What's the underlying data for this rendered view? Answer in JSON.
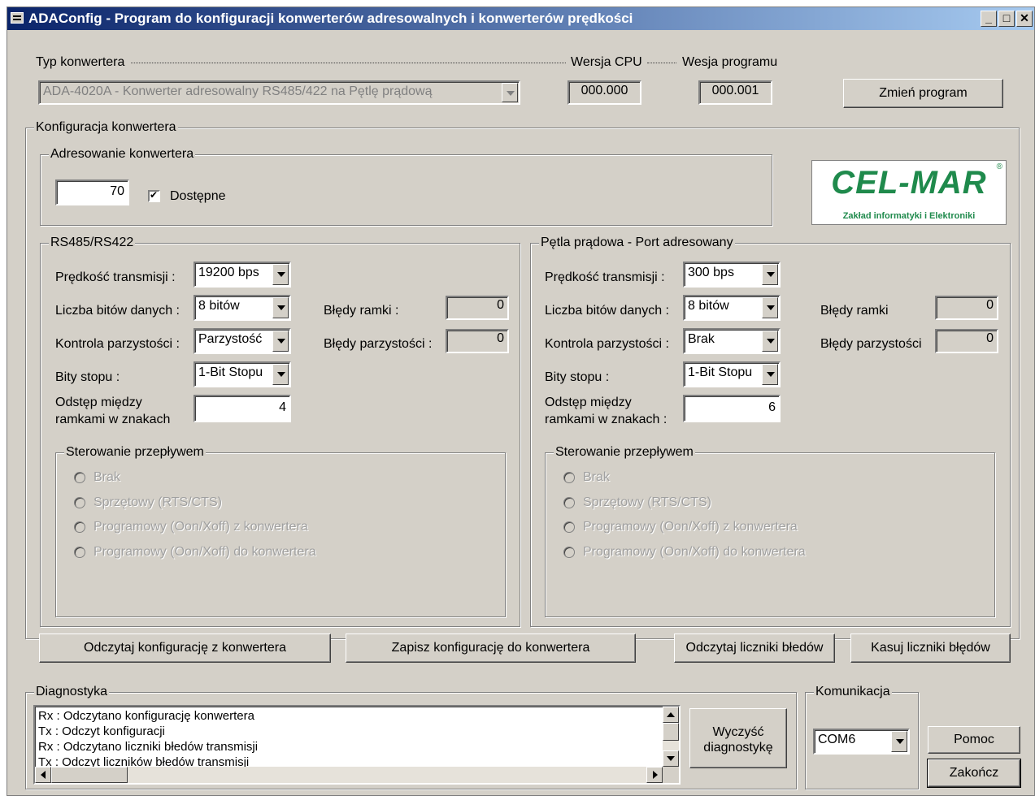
{
  "window": {
    "title": "ADAConfig - Program do konfiguracji konwerterów adresowalnych i konwerterów prędkości",
    "min_symbol": "_",
    "max_symbol": "□",
    "close_symbol": "✕"
  },
  "top": {
    "type_label": "Typ konwertera",
    "type_value": "ADA-4020A - Konwerter adresowalny RS485/422 na Pętlę prądową",
    "cpu_label": "Wersja CPU",
    "cpu_value": "000.000",
    "prog_label": "Wesja programu",
    "prog_value": "000.001",
    "change_button": "Zmień program"
  },
  "config": {
    "label": "Konfiguracja konwertera",
    "addressing": {
      "label": "Adresowanie konwertera",
      "address": "70",
      "available_label": "Dostępne",
      "available_checked": true
    },
    "logo": {
      "name": "CEL-MAR",
      "reg": "®",
      "subtitle": "Zakład informatyki i Elektroniki",
      "color": "#1f8a4c"
    },
    "rs": {
      "label": "RS485/RS422",
      "speed_label": "Prędkość transmisji :",
      "speed": "19200 bps",
      "bits_label": "Liczba bitów danych :",
      "bits": "8 bitów",
      "parity_label": "Kontrola parzystości :",
      "parity": "Parzystość",
      "stop_label": "Bity stopu :",
      "stop": "1-Bit Stopu",
      "gap_label_1": "Odstęp między",
      "gap_label_2": "ramkami w znakach",
      "gap": "4",
      "frame_err_label": "Błędy ramki :",
      "frame_err": "0",
      "parity_err_label": "Błędy parzystości :",
      "parity_err": "0",
      "flow": {
        "label": "Sterowanie przepływem",
        "options": [
          "Brak",
          "Sprzętowy (RTS/CTS)",
          "Programowy (Oon/Xoff) z konwertera",
          "Programowy (Oon/Xoff) do konwertera"
        ]
      }
    },
    "loop": {
      "label": "Pętla prądowa - Port adresowany",
      "speed_label": "Prędkość transmisji :",
      "speed": "300 bps",
      "bits_label": "Liczba bitów danych :",
      "bits": "8 bitów",
      "parity_label": "Kontrola parzystości :",
      "parity": "Brak",
      "stop_label": "Bity stopu :",
      "stop": "1-Bit Stopu",
      "gap_label_1": "Odstęp między",
      "gap_label_2": "ramkami w znakach :",
      "gap": "6",
      "frame_err_label": "Błędy ramki",
      "frame_err": "0",
      "parity_err_label": "Błędy parzystości",
      "parity_err": "0",
      "flow": {
        "label": "Sterowanie przepływem",
        "options": [
          "Brak",
          "Sprzętowy (RTS/CTS)",
          "Programowy (Oon/Xoff) z konwertera",
          "Programowy (Oon/Xoff) do konwertera"
        ]
      }
    }
  },
  "actions": {
    "read_config": "Odczytaj konfigurację z konwertera",
    "write_config": "Zapisz konfigurację do konwertera",
    "read_counters": "Odczytaj liczniki błedów",
    "reset_counters": "Kasuj liczniki błędów"
  },
  "diag": {
    "label": "Diagnostyka",
    "lines": [
      "Rx : Odczytano konfigurację konwertera",
      "Tx : Odczyt konfiguracji",
      "Rx : Odczytano liczniki błedów transmisji",
      "Tx : Odczyt liczników błedów transmisji"
    ],
    "clear_1": "Wyczyść",
    "clear_2": "diagnostykę"
  },
  "comm": {
    "label": "Komunikacja",
    "port": "COM6"
  },
  "help_button": "Pomoc",
  "exit_button": "Zakończ"
}
